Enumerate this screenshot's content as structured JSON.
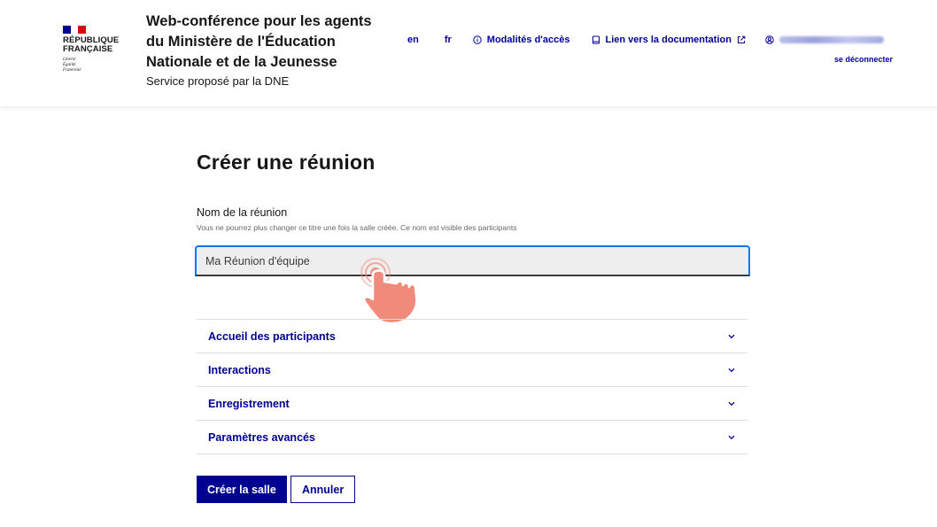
{
  "header": {
    "logo": {
      "title": "République\nFrançaise",
      "motto": "Liberté\nÉgalité\nFraternité"
    },
    "service_title": "Web-conférence pour les agents\ndu Ministère de l'Éducation\nNationale et de la Jeunesse",
    "service_tagline": "Service proposé par la DNE",
    "tools": {
      "lang_en": "en",
      "lang_fr": "fr",
      "access": "Modalités d'accès",
      "docs": "Lien vers la documentation",
      "logout": "se déconnecter"
    }
  },
  "main": {
    "title": "Créer une réunion",
    "name_field": {
      "label": "Nom de la réunion",
      "hint": "Vous ne pourrez plus changer ce titre une fois la salle créée. Ce nom est visible des participants",
      "value": "Ma Réunion d'équipe"
    },
    "sections": [
      {
        "label": "Accueil des participants"
      },
      {
        "label": "Interactions"
      },
      {
        "label": "Enregistrement"
      },
      {
        "label": "Paramètres avancés"
      }
    ],
    "buttons": {
      "create": "Créer la salle",
      "cancel": "Annuler"
    }
  },
  "colors": {
    "brand_blue": "#000091",
    "focus_blue": "#0a76f6",
    "marianne_red": "#e1000f",
    "touch_indicator": "#f08a7a"
  },
  "icons": [
    "info-icon",
    "book-icon",
    "external-link-icon",
    "user-circle-icon",
    "chevron-down-icon",
    "touch-hand-icon"
  ]
}
